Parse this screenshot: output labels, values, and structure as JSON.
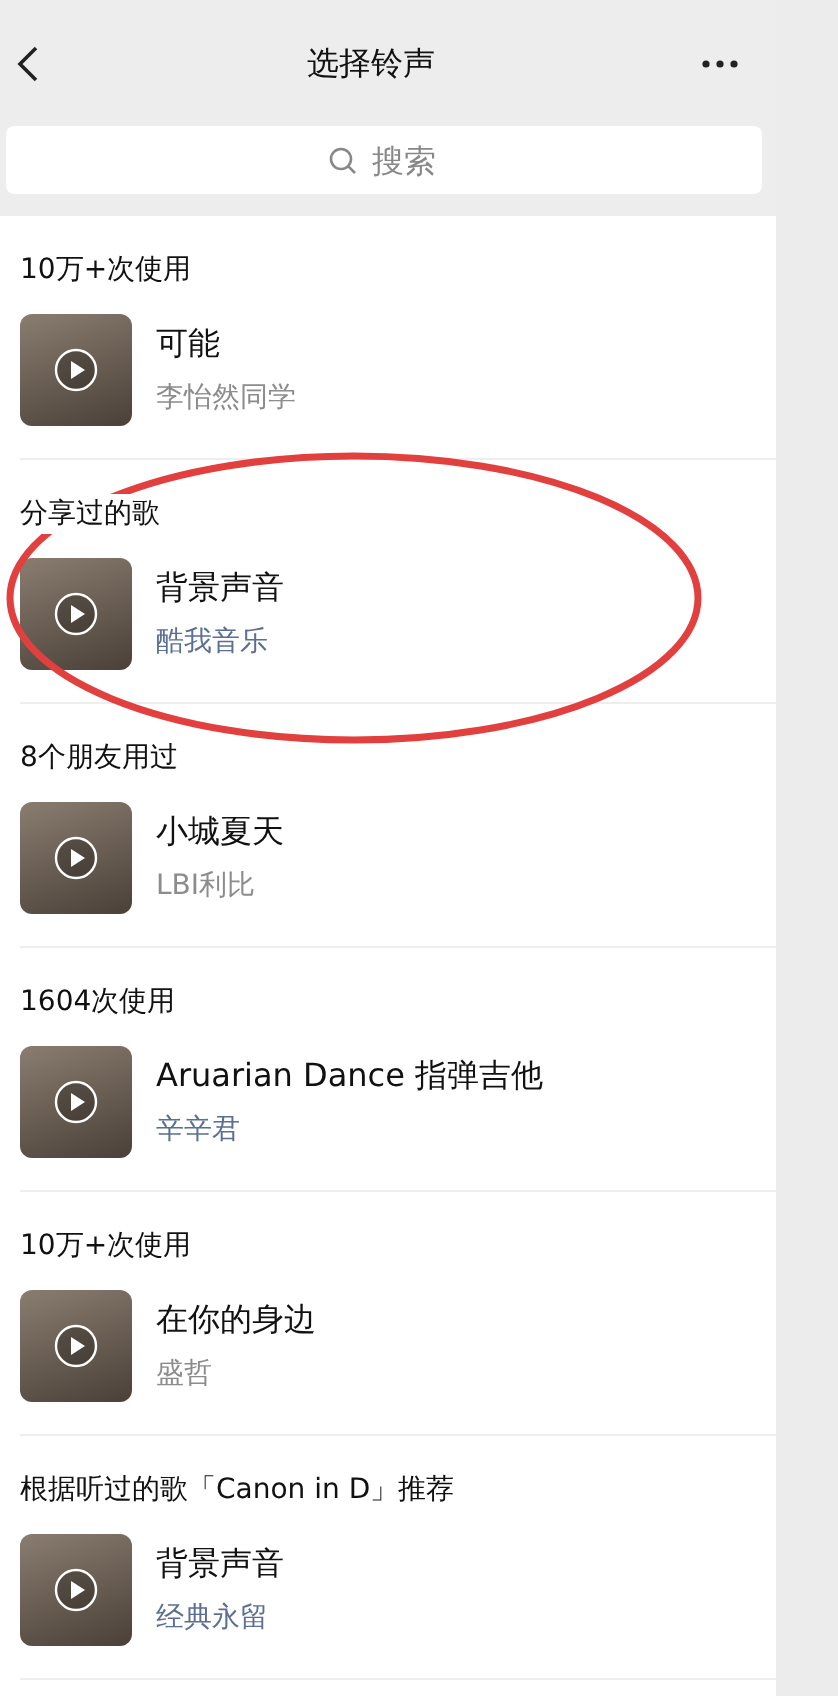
{
  "header": {
    "title": "选择铃声"
  },
  "search": {
    "placeholder": "搜索"
  },
  "sections": [
    {
      "heading": "10万+次使用",
      "song": {
        "title": "可能",
        "artist": "李怡然同学",
        "linked": false
      },
      "circled": false
    },
    {
      "heading": "分享过的歌",
      "song": {
        "title": "背景声音",
        "artist": "酷我音乐",
        "linked": true
      },
      "circled": true
    },
    {
      "heading": "8个朋友用过",
      "song": {
        "title": "小城夏天",
        "artist": "LBI利比",
        "linked": false
      },
      "circled": false
    },
    {
      "heading": "1604次使用",
      "song": {
        "title": "Aruarian Dance 指弹吉他",
        "artist": "辛辛君",
        "linked": true
      },
      "circled": false
    },
    {
      "heading": "10万+次使用",
      "song": {
        "title": "在你的身边",
        "artist": "盛哲",
        "linked": false
      },
      "circled": false
    },
    {
      "heading": "根据听过的歌「Canon in D」推荐",
      "song": {
        "title": "背景声音",
        "artist": "经典永留",
        "linked": true
      },
      "circled": false
    }
  ]
}
